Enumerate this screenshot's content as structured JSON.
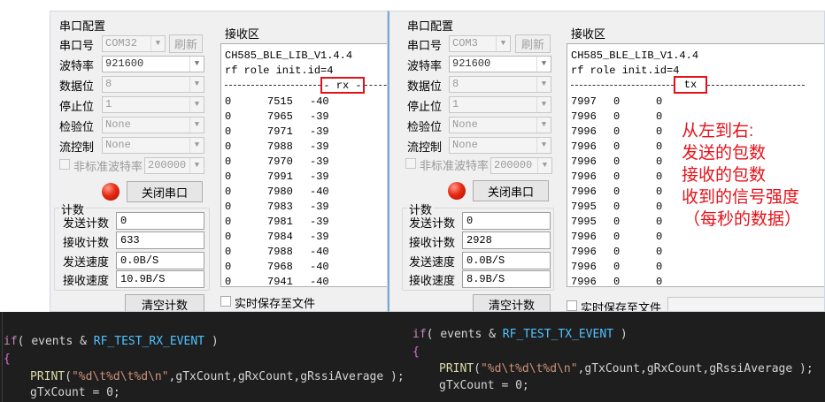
{
  "annotation_lines": [
    "从左到右:",
    "发送的包数",
    "接收的包数",
    "收到的信号强度",
    "（每秒的数据）"
  ],
  "left_window": {
    "config_title": "串口配置",
    "fields": [
      {
        "label": "串口号",
        "value": "COM32"
      },
      {
        "label": "波特率",
        "value": "921600"
      },
      {
        "label": "数据位",
        "value": "8"
      },
      {
        "label": "停止位",
        "value": "1"
      },
      {
        "label": "检验位",
        "value": "None"
      },
      {
        "label": "流控制",
        "value": "None"
      }
    ],
    "refresh_label": "刷新",
    "nonstandard_label": "非标准波特率",
    "nonstandard_value": "200000",
    "close_port_label": "关闭串口",
    "count_title": "计数",
    "counts": [
      {
        "label": "发送计数",
        "value": "0"
      },
      {
        "label": "接收计数",
        "value": "633"
      },
      {
        "label": "发送速度",
        "value": "0.0B/S"
      },
      {
        "label": "接收速度",
        "value": "10.9B/S"
      }
    ],
    "clear_label": "清空计数",
    "recv_title": "接收区",
    "header_lines": [
      "CH585_BLE_LIB_V1.4.4",
      "rf role init.id=4"
    ],
    "mode_marker": "- rx -",
    "rows": [
      [
        "0",
        "7515",
        "-40"
      ],
      [
        "0",
        "7965",
        "-39"
      ],
      [
        "0",
        "7971",
        "-39"
      ],
      [
        "0",
        "7988",
        "-39"
      ],
      [
        "0",
        "7970",
        "-39"
      ],
      [
        "0",
        "7991",
        "-39"
      ],
      [
        "0",
        "7980",
        "-40"
      ],
      [
        "0",
        "7983",
        "-39"
      ],
      [
        "0",
        "7981",
        "-39"
      ],
      [
        "0",
        "7984",
        "-39"
      ],
      [
        "0",
        "7988",
        "-40"
      ],
      [
        "0",
        "7968",
        "-40"
      ],
      [
        "0",
        "7941",
        "-40"
      ]
    ],
    "save_label": "实时保存至文件"
  },
  "right_window": {
    "config_title": "串口配置",
    "fields": [
      {
        "label": "串口号",
        "value": "COM3"
      },
      {
        "label": "波特率",
        "value": "921600"
      },
      {
        "label": "数据位",
        "value": "8"
      },
      {
        "label": "停止位",
        "value": "1"
      },
      {
        "label": "检验位",
        "value": "None"
      },
      {
        "label": "流控制",
        "value": "None"
      }
    ],
    "refresh_label": "刷新",
    "nonstandard_label": "非标准波特率",
    "nonstandard_value": "200000",
    "close_port_label": "关闭串口",
    "count_title": "计数",
    "counts": [
      {
        "label": "发送计数",
        "value": "0"
      },
      {
        "label": "接收计数",
        "value": "2928"
      },
      {
        "label": "发送速度",
        "value": "0.0B/S"
      },
      {
        "label": "接收速度",
        "value": "8.9B/S"
      }
    ],
    "clear_label": "清空计数",
    "recv_title": "接收区",
    "header_lines": [
      "CH585_BLE_LIB_V1.4.4",
      "rf role init.id=4"
    ],
    "mode_marker": "tx",
    "rows": [
      [
        "7997",
        "0",
        "0"
      ],
      [
        "7996",
        "0",
        "0"
      ],
      [
        "7996",
        "0",
        "0"
      ],
      [
        "7996",
        "0",
        "0"
      ],
      [
        "7996",
        "0",
        "0"
      ],
      [
        "7996",
        "0",
        "0"
      ],
      [
        "7996",
        "0",
        "0"
      ],
      [
        "7995",
        "0",
        "0"
      ],
      [
        "7995",
        "0",
        "0"
      ],
      [
        "7996",
        "0",
        "0"
      ],
      [
        "7996",
        "0",
        "0"
      ],
      [
        "7996",
        "0",
        "0"
      ],
      [
        "7996",
        "0",
        "0"
      ]
    ],
    "save_label": "实时保存至文件"
  },
  "code_left": {
    "if_kw": "if",
    "events": "events",
    "amp": "&",
    "event_name": "RF_TEST_RX_EVENT",
    "open_brace": "{",
    "print_fn": "PRINT",
    "format_string": "\"%d\\t%d\\t%d\\n\"",
    "print_args": ",gTxCount,gRxCount,gRssiAverage );",
    "next_line": "gTxCount = 0;"
  },
  "code_right": {
    "if_kw": "if",
    "events": "events",
    "amp": "&",
    "event_name": "RF_TEST_TX_EVENT",
    "open_brace": "{",
    "print_fn": "PRINT",
    "format_string": "\"%d\\t%d\\t%d\\n\"",
    "print_args": ",gTxCount,gRxCount,gRssiAverage );",
    "next_line": "gTxCount = 0;"
  }
}
